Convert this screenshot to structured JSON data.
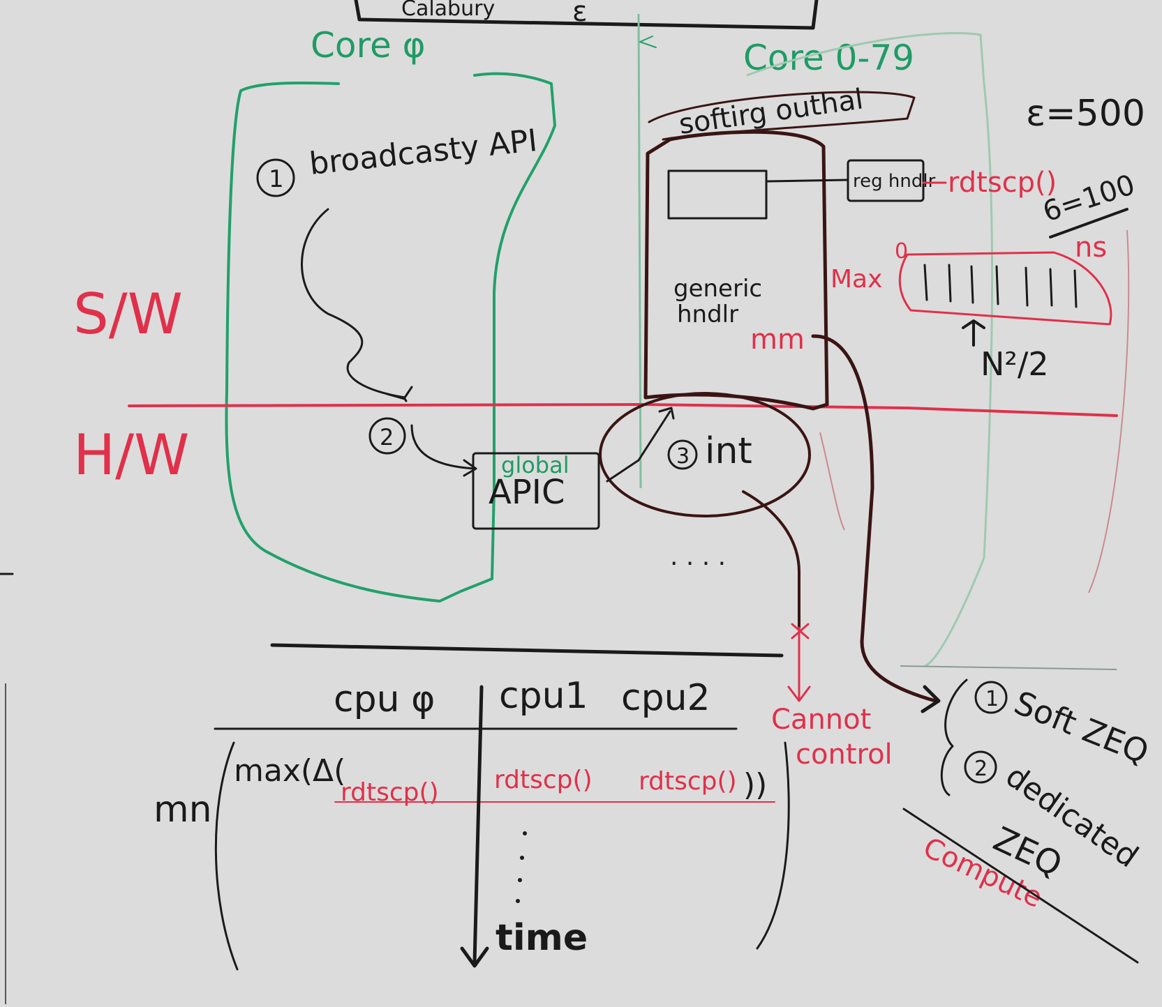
{
  "whiteboard": {
    "top_label": "Calabury",
    "top_epsilon": "ε",
    "core0_label": "Core φ",
    "core_range_label": "Core 0-79",
    "epsilon_value": "ε=500",
    "sigma_value": "6=100",
    "ns_label": "ns",
    "sw_label": "S/W",
    "hw_label": "H/W",
    "step1_num": "1",
    "step1_text": "broadcasty API",
    "step2_num": "2",
    "step3_num": "3",
    "step3_text": "int",
    "global_label": "global",
    "apic_label": "APIC",
    "softirq_label": "softirg outhal",
    "reg_handler": "reg hndlr",
    "rdtscp_right": "rdtscp()",
    "generic_handler_1": "generic",
    "generic_handler_2": "hndlr",
    "mm_handler": "mm",
    "max_label": "Max",
    "zero_label": "0",
    "n2_label": "N²/2",
    "ellipsis": ". . . .",
    "cannot_1": "Cannot",
    "cannot_2": "control",
    "softzeq_num": "1",
    "softzeq_text": "Soft ZEQ",
    "dedicated_num": "2",
    "dedicated_text_1": "dedicated",
    "dedicated_text_2": "ZEQ",
    "compute_label": "Compute",
    "cpu0_label": "cpu φ",
    "cpu1_label": "cpu1",
    "cpu2_label": "cpu2",
    "min_label": "mn",
    "max_formula": "max(Δ(",
    "rdtscp_a": "rdtscp()",
    "rdtscp_b": "rdtscp()",
    "rdtscp_c": "rdtscp()",
    "close_parens": "))",
    "time_label": "time"
  },
  "colors": {
    "black_ink": "#1a1a1a",
    "green_ink": "#22a06b",
    "red_ink": "#e0304a",
    "brown_ink": "#3a1414",
    "board": "#dcdcdc"
  }
}
